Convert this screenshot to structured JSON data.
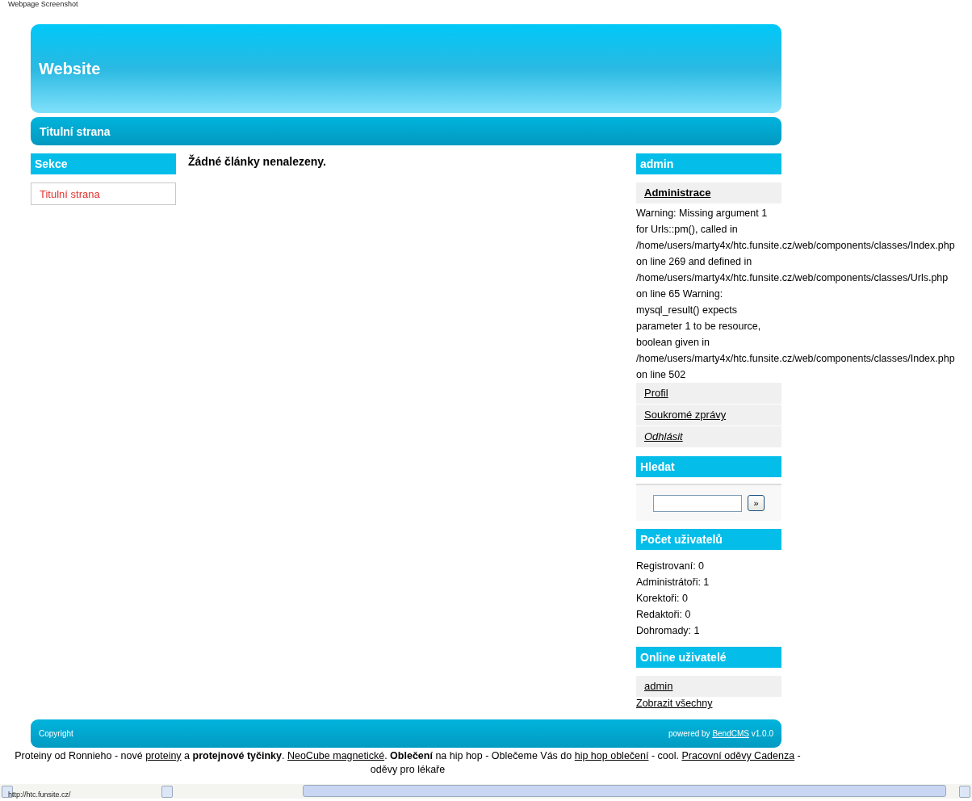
{
  "browser_caption": "Webpage Screenshot",
  "header": {
    "title": "Website"
  },
  "nav": {
    "items": [
      {
        "label": "Titulní strana"
      }
    ]
  },
  "left_column": {
    "title": "Sekce",
    "items": [
      {
        "label": "Titulní strana"
      }
    ]
  },
  "main": {
    "message": "Žádné články nenalezeny."
  },
  "right_column": {
    "user_box": {
      "title": "admin",
      "admin_link": "Administrace",
      "warning": "Warning: Missing argument 1\nfor Urls::pm(), called in\n/home/users/marty4x/htc.funsite.cz/web/components/classes/Index.php\non line 269 and defined in\n/home/users/marty4x/htc.funsite.cz/web/components/classes/Urls.php\non line 65 Warning:\nmysql_result() expects\nparameter 1 to be resource,\nboolean given in\n/home/users/marty4x/htc.funsite.cz/web/components/classes/Index.php\non line 502",
      "links": [
        {
          "label": "Profil",
          "italic": false
        },
        {
          "label": "Soukromé zprávy",
          "italic": false
        },
        {
          "label": "Odhlásit",
          "italic": true
        }
      ]
    },
    "search_box": {
      "title": "Hledat",
      "button": "»"
    },
    "stats_box": {
      "title": "Počet uživatelů",
      "lines": [
        "Registrovaní: 0",
        "Administrátoři: 1",
        "Korektoři: 0",
        "Redaktoři: 0",
        "Dohromady: 1"
      ]
    },
    "online_box": {
      "title": "Online uživatelé",
      "users": [
        "admin"
      ],
      "show_all": "Zobrazit všechny"
    }
  },
  "footer": {
    "copyright": "Copyright",
    "powered_prefix": "powered by",
    "powered_link": "BendCMS",
    "version": "v1.0.0"
  },
  "ad_line": [
    {
      "kind": "text",
      "text": "Proteiny od Ronnieho - nové "
    },
    {
      "kind": "link",
      "text": "proteiny"
    },
    {
      "kind": "text",
      "text": " a "
    },
    {
      "kind": "bold",
      "text": "protejnové tyčinky"
    },
    {
      "kind": "text",
      "text": ". "
    },
    {
      "kind": "link",
      "text": "NeoCube magnetické"
    },
    {
      "kind": "text",
      "text": ". "
    },
    {
      "kind": "bold",
      "text": "Oblečení"
    },
    {
      "kind": "text",
      "text": " na hip hop - Oblečeme Vás do "
    },
    {
      "kind": "link",
      "text": "hip hop oblečení"
    },
    {
      "kind": "text",
      "text": " - cool. "
    },
    {
      "kind": "link",
      "text": "Pracovní oděvy Cadenza"
    },
    {
      "kind": "text",
      "text": " - oděvy pro lékaře"
    }
  ],
  "status_bar": {
    "url": "http://htc.funsite.cz/"
  }
}
